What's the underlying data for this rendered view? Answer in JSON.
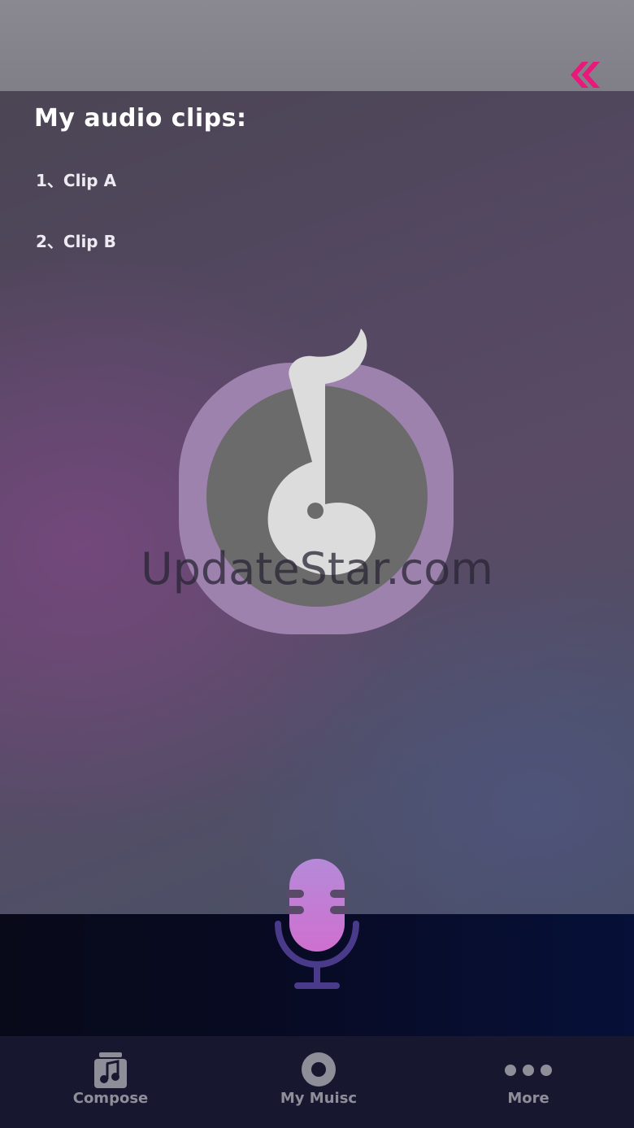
{
  "header": {
    "back_icon": "double-chevron-left-icon",
    "accent_color": "#e8197a"
  },
  "clips": {
    "title": "My audio clips:",
    "items": [
      {
        "label": "1、Clip A"
      },
      {
        "label": "2、Clip B"
      }
    ]
  },
  "center": {
    "logo_icon": "music-note-logo-icon",
    "watermark": "UpdateStar.com"
  },
  "recorder": {
    "mic_icon": "microphone-icon"
  },
  "tabs": [
    {
      "label": "Compose",
      "icon": "music-note-icon"
    },
    {
      "label": "My Muisc",
      "icon": "disc-icon"
    },
    {
      "label": "More",
      "icon": "more-dots-icon"
    }
  ]
}
